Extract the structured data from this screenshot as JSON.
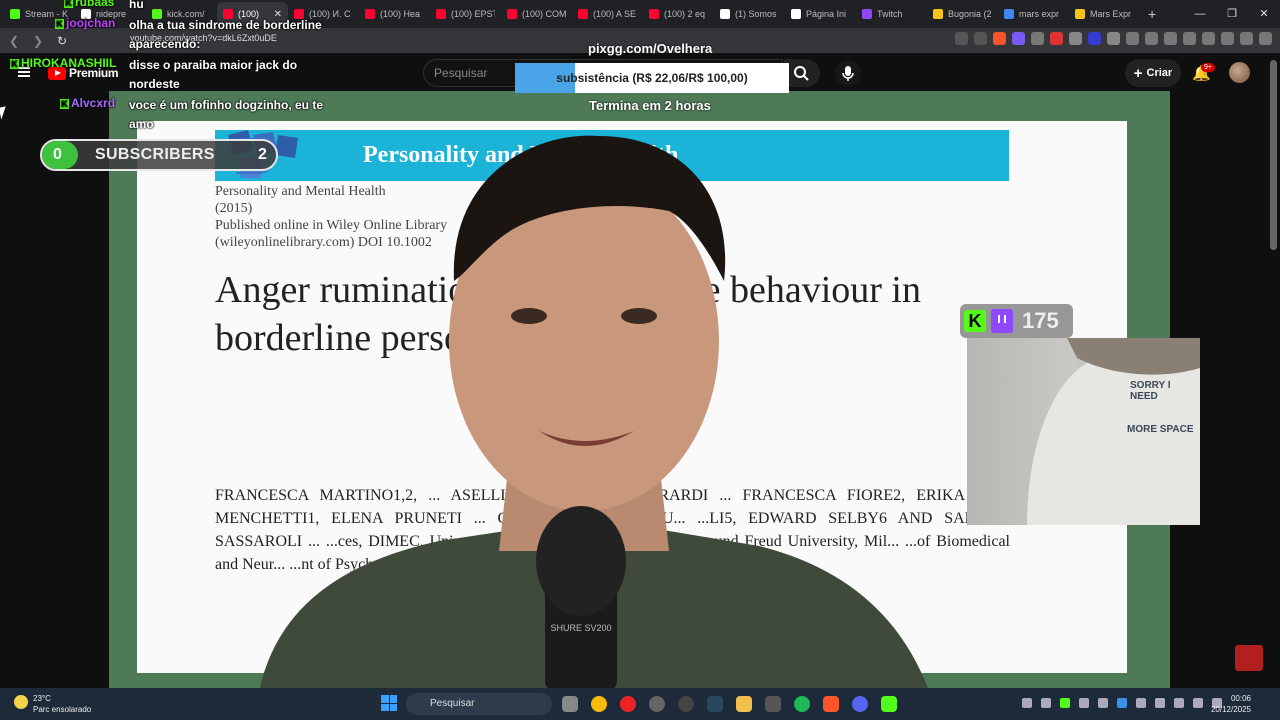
{
  "browser": {
    "tabs": [
      {
        "label": "Stream - K",
        "favicon_color": "#53fc18"
      },
      {
        "label": "nidepre",
        "favicon_color": "#ffffff"
      },
      {
        "label": "kick.com/",
        "favicon_color": "#53fc18"
      },
      {
        "label": "(100)",
        "favicon_color": "#ff0033",
        "active": true
      },
      {
        "label": "(100) И. С",
        "favicon_color": "#ff0033"
      },
      {
        "label": "(100) Hea",
        "favicon_color": "#ff0033"
      },
      {
        "label": "(100) EPST",
        "favicon_color": "#ff0033"
      },
      {
        "label": "(100) COM",
        "favicon_color": "#ff0033"
      },
      {
        "label": "(100) A SE",
        "favicon_color": "#ff0033"
      },
      {
        "label": "(100) 2 eq",
        "favicon_color": "#ff0033"
      },
      {
        "label": "(1) Somos",
        "favicon_color": "#ffffff"
      },
      {
        "label": "Página Ini",
        "favicon_color": "#ffffff"
      },
      {
        "label": "Twitch",
        "favicon_color": "#9146ff"
      },
      {
        "label": "Bugonia (2",
        "favicon_color": "#f5c518"
      },
      {
        "label": "mars expr",
        "favicon_color": "#4285f4"
      },
      {
        "label": "Mars Expr",
        "favicon_color": "#f5c518"
      }
    ],
    "new_tab": "+",
    "url": "youtube.com/watch?v=dkL6Zxt0uDE"
  },
  "youtube": {
    "logo_text": "Premium",
    "search_placeholder": "Pesquisar",
    "create_label": "Criar",
    "notifications_badge": "9+"
  },
  "overlay": {
    "chat": [
      {
        "user": "",
        "message": "hu",
        "user_color": "#53fc18"
      },
      {
        "user": "joojchan",
        "message": "olha a tua sindrome de borderline aparecendo:",
        "user_color": "#c040ff"
      },
      {
        "user": "HIROKANASHIIL",
        "message": "disse o paraiba maior jack do nordeste",
        "user_color": "#53fc18"
      },
      {
        "user": "Alvcxrd",
        "message": "voce é um fofinho dogzinho, eu te amo",
        "user_color": "#a66bff"
      }
    ],
    "subscribers": {
      "current": "0",
      "label": "SUBSCRIBERS",
      "goal": "2"
    },
    "donation": {
      "title": "pixgg.com/Ovelhera",
      "goal_label": "subsistência (R$ 22,06/R$ 100,00)",
      "raised": 22.06,
      "target": 100.0,
      "ends": "Termina em 2 horas"
    },
    "viewers": "175"
  },
  "paper": {
    "journal_banner": "Personality and Mental Health",
    "journal_meta": [
      "Personality and Mental Health",
      "(2015)",
      "Published online in Wiley Online Library",
      "(wileyonlinelibrary.com) DOI 10.1002"
    ],
    "title": "Anger rumination and aggressive behaviour in borderline personality disorder",
    "authors": "FRANCESCA MARTINO1,2, ... ASELLI2,3, DOMENICO BERARDI ... FRANCESCA FIORE2, ERIKA ... O MENCHETTI1, ELENA PRUNETI ... GIOVANNI MARIA RU... ...LI5, EDWARD SELBY6 AND SANDRA SASSAROLI ... ...ces, DIMEC, University of Bologna, Italy; 2S... ...3Sigmund Freud University, Mil... ...of Biomedical and Neur... ...nt of Psychology, Rut..."
  },
  "webcam_shirt": [
    "SORRY I NEED",
    "MORE SPACE"
  ],
  "taskbar": {
    "temperature": "23°C",
    "weather": "Parc ensolarado",
    "search_placeholder": "Pesquisar",
    "time": "00:06",
    "date": "20/12/2025"
  }
}
